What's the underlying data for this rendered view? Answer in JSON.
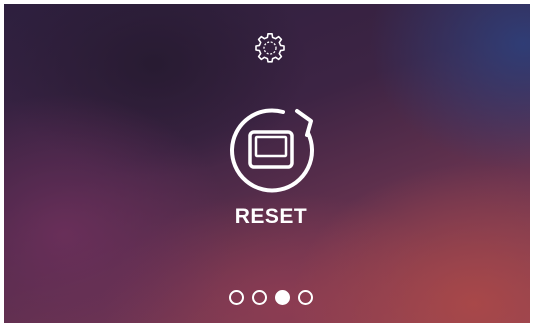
{
  "settings": {
    "icon": "gear-icon"
  },
  "reset": {
    "label": "RESET",
    "icon": "device-reset-icon"
  },
  "pagination": {
    "count": 4,
    "active_index": 2,
    "color": "#ffffff"
  }
}
